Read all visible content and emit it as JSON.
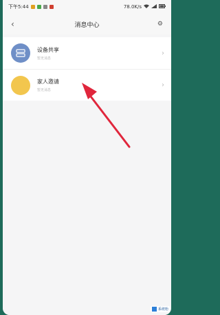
{
  "status_bar": {
    "time": "下午5:44",
    "network_speed": "78.0K/s",
    "battery": "",
    "colors": [
      "#e0a020",
      "#4aa84a",
      "#888888",
      "#d04030"
    ]
  },
  "header": {
    "title": "消息中心",
    "back_icon": "back-arrow-icon",
    "settings_icon": "gear-icon"
  },
  "list": {
    "items": [
      {
        "label": "设备共享",
        "subtitle": "暂无消息",
        "icon": "device-share-icon",
        "color": "#6f8fc7"
      },
      {
        "label": "家人邀请",
        "subtitle": "暂无消息",
        "icon": "family-invite-icon",
        "color": "#f2c64e"
      }
    ]
  },
  "annotation": {
    "arrow_color": "#e0263c"
  },
  "watermark": {
    "text": "系统粉"
  }
}
